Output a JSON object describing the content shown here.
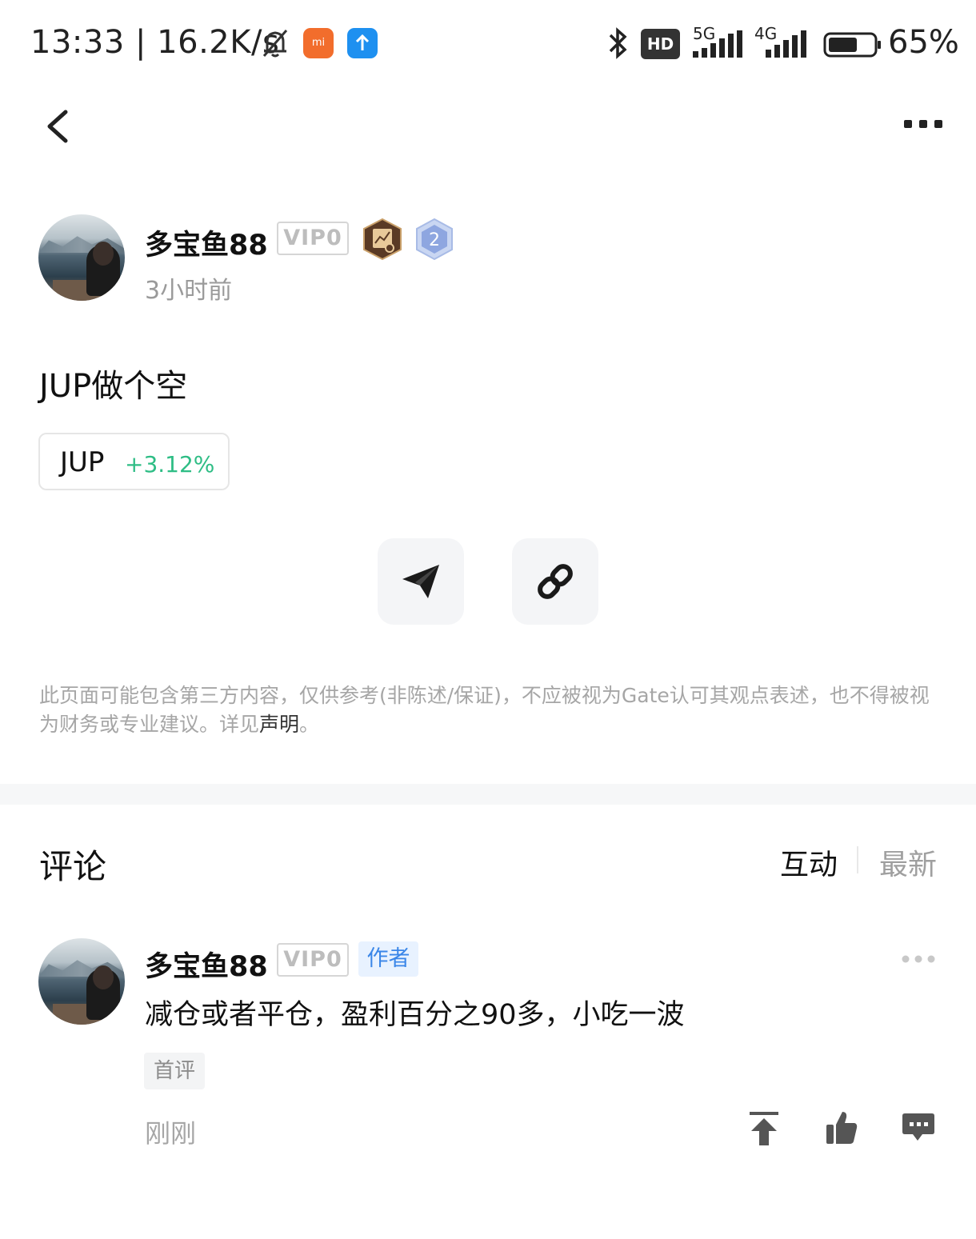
{
  "status_bar": {
    "time_speed": "13:33 | 16.2K/s",
    "app1_label": "mi",
    "hd_label": "HD",
    "net1": "5G",
    "net2": "4G",
    "battery": "65%",
    "battery_level_percent": 65
  },
  "nav": {
    "back_icon": "chevron-left-icon",
    "more_icon": "ellipsis-icon"
  },
  "post": {
    "author": "多宝鱼88",
    "vip": "VIP0",
    "level_badge": "2",
    "time": "3小时前",
    "text": "JUP做个空",
    "coin": {
      "symbol": "JUP",
      "change": "+3.12%",
      "change_color": "#2ebd85"
    },
    "share_icons": [
      "send-icon",
      "link-icon"
    ]
  },
  "disclaimer": {
    "text": "此页面可能包含第三方内容，仅供参考(非陈述/保证)，不应被视为Gate认可其观点表述，也不得被视为财务或专业建议。详见",
    "link": "声明",
    "end": "。"
  },
  "comments": {
    "title": "评论",
    "sort_tabs": [
      {
        "label": "互动",
        "active": true
      },
      {
        "label": "最新",
        "active": false
      }
    ],
    "items": [
      {
        "author": "多宝鱼88",
        "vip": "VIP0",
        "tag": "作者",
        "text": "减仓或者平仓，盈利百分之90多，小吃一波",
        "badge": "首评",
        "time": "刚刚",
        "actions": [
          "pin-top-icon",
          "thumbs-up-icon",
          "comment-icon"
        ]
      }
    ]
  }
}
